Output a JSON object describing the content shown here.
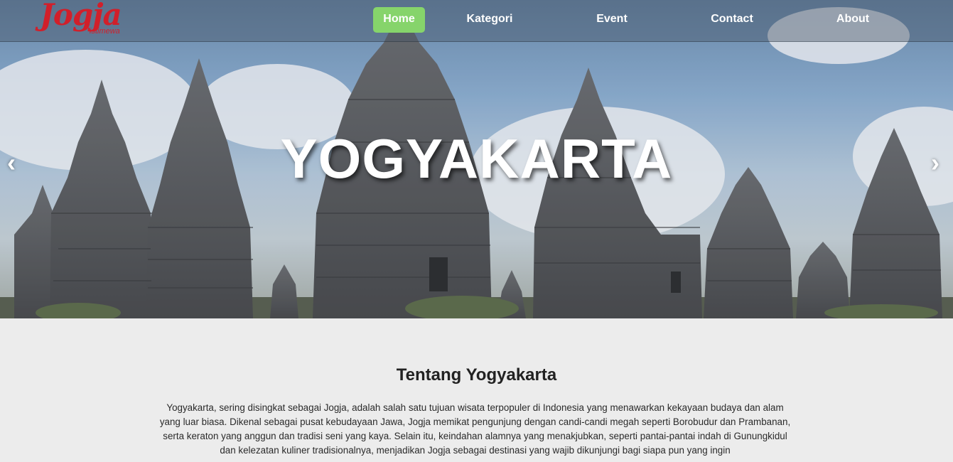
{
  "logo": {
    "main": "Jogja",
    "sub": "istimewa"
  },
  "nav": {
    "items": [
      "Home",
      "Kategori",
      "Event",
      "Contact",
      "About"
    ],
    "active": "Home",
    "active_color": "#86d46b"
  },
  "hero": {
    "title": "YOGYAKARTA",
    "prev_arrow": "‹",
    "next_arrow": "›"
  },
  "about": {
    "title": "Tentang Yogyakarta",
    "text": "Yogyakarta, sering disingkat sebagai Jogja, adalah salah satu tujuan wisata terpopuler di Indonesia yang menawarkan kekayaan budaya dan alam yang luar biasa. Dikenal sebagai pusat kebudayaan Jawa, Jogja memikat pengunjung dengan candi-candi megah seperti Borobudur dan Prambanan, serta keraton yang anggun dan tradisi seni yang kaya. Selain itu, keindahan alamnya yang menakjubkan, seperti pantai-pantai indah di Gunungkidul dan kelezatan kuliner tradisionalnya, menjadikan Jogja sebagai destinasi yang wajib dikunjungi bagi siapa pun yang ingin"
  },
  "colors": {
    "logo": "#d11f2a",
    "page_bg": "#ececec"
  }
}
